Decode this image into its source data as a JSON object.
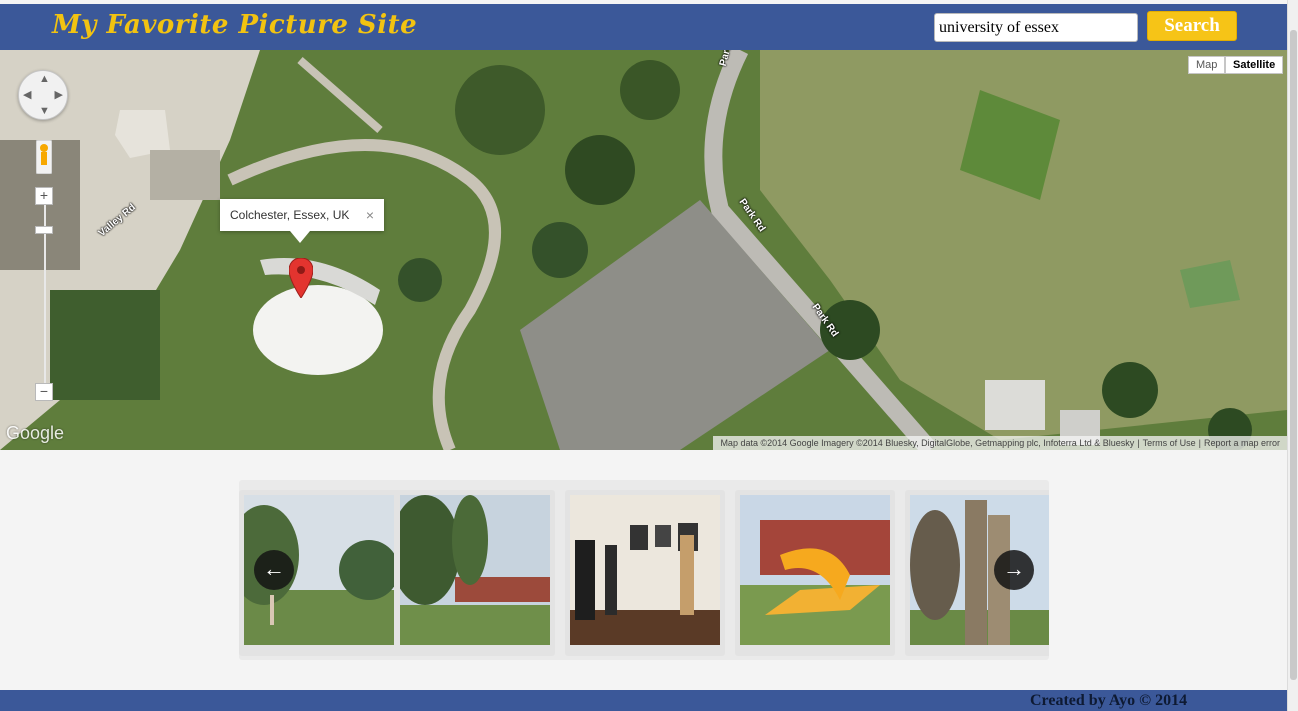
{
  "header": {
    "site_title": "My Favorite Picture Site",
    "search_value": "university of essex",
    "search_button": "Search"
  },
  "map": {
    "map_type_map": "Map",
    "map_type_satellite": "Satellite",
    "info_window_text": "Colchester, Essex, UK",
    "info_close": "×",
    "zoom_in": "+",
    "zoom_out": "−",
    "logo": "Google",
    "attribution": "Map data ©2014 Google Imagery ©2014 Bluesky, DigitalGlobe, Getmapping plc, Infoterra Ltd & Bluesky",
    "terms": "Terms of Use",
    "report": "Report a map error",
    "road_labels": [
      "Valley Rd",
      "Park Rd",
      "Park Rd",
      "Park"
    ]
  },
  "carousel": {
    "prev": "←",
    "next": "→",
    "thumbnails": [
      {
        "subject": "park-with-sculpture"
      },
      {
        "subject": "campus-trees-building"
      },
      {
        "subject": "gallery-visitors"
      },
      {
        "subject": "orange-sculpture"
      },
      {
        "subject": "wooden-sculpture"
      }
    ]
  },
  "footer": {
    "text": "Created by Ayo © 2014"
  },
  "colors": {
    "header_bg": "#3b5899",
    "title": "#f2c311",
    "search_button": "#f6c417"
  }
}
